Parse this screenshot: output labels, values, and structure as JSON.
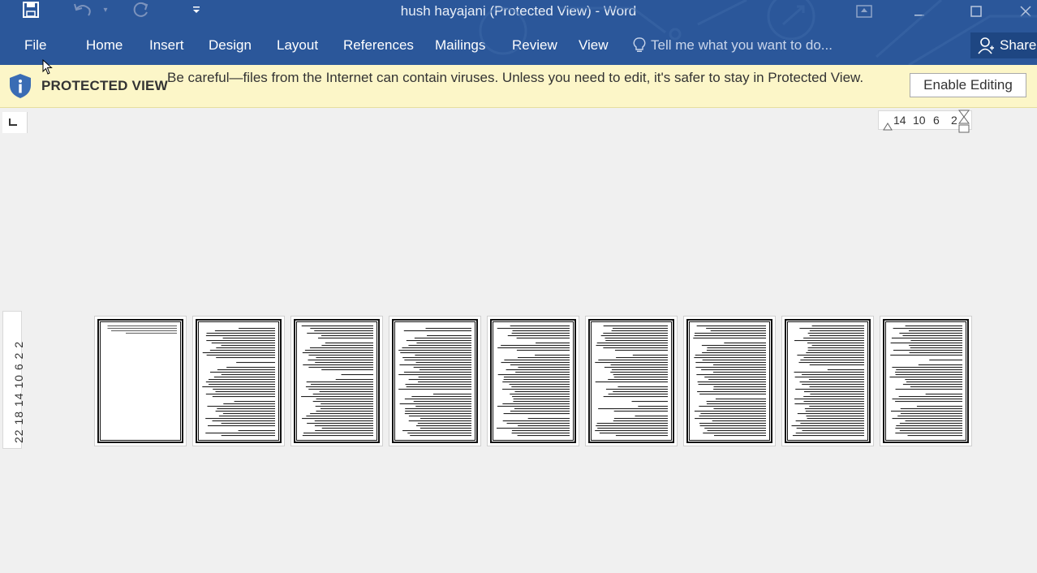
{
  "window": {
    "title": "hush hayajani (Protected View) - Word"
  },
  "quick_access": {
    "save_icon": "save-icon",
    "undo_icon": "undo-icon",
    "redo_icon": "redo-icon",
    "customize_icon": "customize-qat-icon"
  },
  "ribbon": {
    "tabs": [
      "File",
      "Home",
      "Insert",
      "Design",
      "Layout",
      "References",
      "Mailings",
      "Review",
      "View"
    ],
    "tell_me_placeholder": "Tell me what you want to do...",
    "share_label": "Share"
  },
  "protected_view": {
    "label": "PROTECTED VIEW",
    "message": "Be careful—files from the Internet can contain viruses. Unless you need to edit, it's safer to stay in Protected View.",
    "button_label": "Enable Editing",
    "accent_color": "#fcf6c8"
  },
  "ruler": {
    "horizontal_numbers": [
      "14",
      "10",
      "6",
      "2"
    ],
    "vertical_numbers": "22 18 14 10 6 2 2"
  },
  "document": {
    "page_count": 9
  },
  "colors": {
    "ribbon": "#2b579a",
    "canvas": "#f0f0f0"
  }
}
